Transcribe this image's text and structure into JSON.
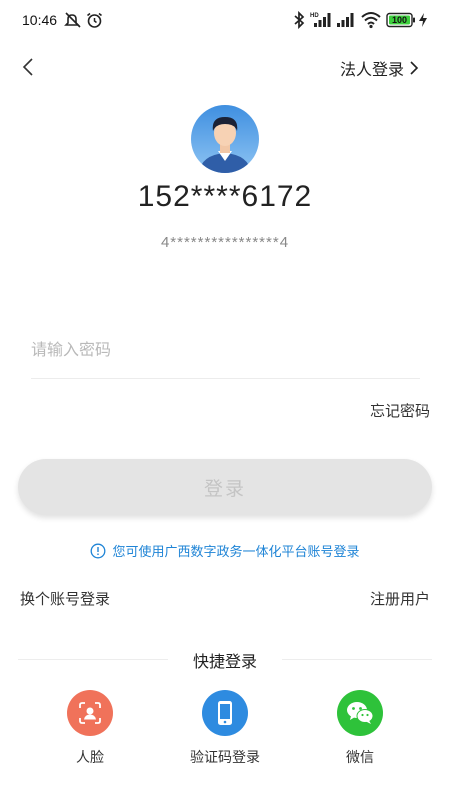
{
  "status_bar": {
    "time": "10:46",
    "battery": "100"
  },
  "header": {
    "legal_login": "法人登录"
  },
  "user": {
    "phone_masked": "152****6172",
    "id_masked": "4****************4"
  },
  "password": {
    "placeholder": "请输入密码",
    "value": ""
  },
  "links": {
    "forgot_password": "忘记密码",
    "switch_account": "换个账号登录",
    "register": "注册用户"
  },
  "login_button": {
    "label": "登录"
  },
  "notice": {
    "text": "您可使用广西数字政务一体化平台账号登录"
  },
  "quick_login": {
    "title": "快捷登录",
    "items": [
      {
        "label": "人脸",
        "icon": "face-icon",
        "color": "#f0725a"
      },
      {
        "label": "验证码登录",
        "icon": "phone-icon",
        "color": "#2e8be0"
      },
      {
        "label": "微信",
        "icon": "wechat-icon",
        "color": "#2ec23a"
      }
    ]
  },
  "colors": {
    "accent": "#1f84d6",
    "button_bg": "#e4e4e4",
    "button_text": "#c4c4c4"
  }
}
